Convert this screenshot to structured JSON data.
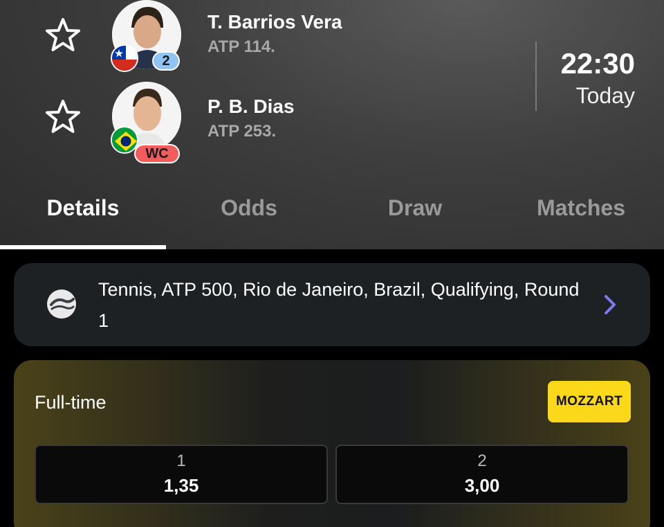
{
  "match": {
    "players": [
      {
        "name": "T. Barrios Vera",
        "rank": "ATP 114.",
        "badge": "2",
        "flag": "chile"
      },
      {
        "name": "P. B. Dias",
        "rank": "ATP 253.",
        "badge": "WC",
        "flag": "brazil"
      }
    ],
    "time": "22:30",
    "day": "Today"
  },
  "tabs": [
    "Details",
    "Odds",
    "Draw",
    "Matches"
  ],
  "tournament": {
    "text": "Tennis, ATP 500, Rio de Janeiro, Brazil, Qualifying, Round 1",
    "icon": "tennis-ball-icon"
  },
  "odds": {
    "title": "Full-time",
    "bookmaker": "MOZZART",
    "options": [
      {
        "label": "1",
        "value": "1,35"
      },
      {
        "label": "2",
        "value": "3,00"
      }
    ]
  },
  "colors": {
    "bookmaker_bg": "#fcd81a",
    "seed_badge": "#8fc4f5",
    "wc_badge": "#f25c5c",
    "chevron": "#7b7bf0"
  }
}
